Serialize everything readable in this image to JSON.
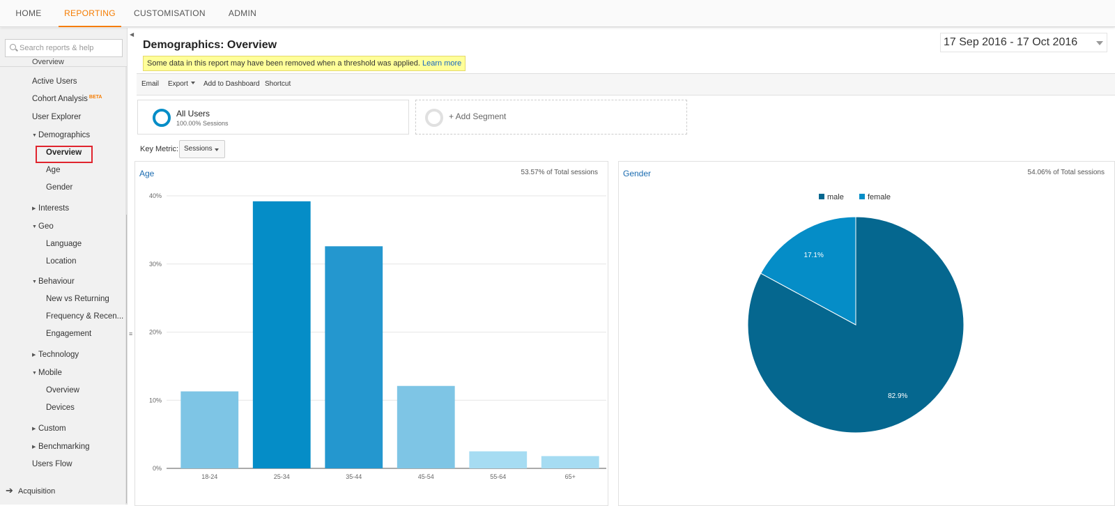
{
  "nav": {
    "tabs": [
      {
        "label": "HOME"
      },
      {
        "label": "REPORTING"
      },
      {
        "label": "CUSTOMISATION"
      },
      {
        "label": "ADMIN"
      }
    ]
  },
  "sidebar": {
    "search_placeholder": "Search reports & help",
    "cut_item": "Overview",
    "items": [
      {
        "label": "Active Users"
      },
      {
        "label": "Cohort Analysis",
        "badge": "BETA"
      },
      {
        "label": "User Explorer"
      },
      {
        "label": "Demographics"
      },
      {
        "label": "Overview"
      },
      {
        "label": "Age"
      },
      {
        "label": "Gender"
      },
      {
        "label": "Interests"
      },
      {
        "label": "Geo"
      },
      {
        "label": "Language"
      },
      {
        "label": "Location"
      },
      {
        "label": "Behaviour"
      },
      {
        "label": "New vs Returning"
      },
      {
        "label": "Frequency & Recen..."
      },
      {
        "label": "Engagement"
      },
      {
        "label": "Technology"
      },
      {
        "label": "Mobile"
      },
      {
        "label": "Overview"
      },
      {
        "label": "Devices"
      },
      {
        "label": "Custom"
      },
      {
        "label": "Benchmarking"
      },
      {
        "label": "Users Flow"
      }
    ],
    "acquisition": "Acquisition"
  },
  "header": {
    "title": "Demographics: Overview",
    "notice": "Some data in this report may have been removed when a threshold was applied.",
    "notice_link": "Learn more",
    "date_range": "17 Sep 2016 - 17 Oct 2016"
  },
  "toolbar": {
    "email": "Email",
    "export": "Export",
    "add_dashboard": "Add to Dashboard",
    "shortcut": "Shortcut"
  },
  "segments": {
    "all_name": "All Users",
    "all_sub": "100.00% Sessions",
    "add_label": "+ Add Segment"
  },
  "key_metric": {
    "label": "Key Metric:",
    "value": "Sessions"
  },
  "age_card": {
    "title": "Age",
    "pct": "53.57% of Total sessions"
  },
  "gender_card": {
    "title": "Gender",
    "pct": "54.06% of Total sessions"
  },
  "colors": {
    "accent": "#f57c00",
    "male": "#05678f",
    "female": "#058dc7"
  },
  "chart_data": [
    {
      "type": "bar",
      "categories": [
        "18-24",
        "25-34",
        "35-44",
        "45-54",
        "55-64",
        "65+"
      ],
      "values": [
        11.3,
        39.2,
        32.6,
        12.1,
        2.5,
        1.8
      ],
      "colors": [
        "#7ec5e5",
        "#058dc7",
        "#2497cf",
        "#7ec5e5",
        "#a6dcf2",
        "#a6dcf2"
      ],
      "ylim": [
        0,
        40
      ],
      "yticks": [
        "0%",
        "10%",
        "20%",
        "30%",
        "40%"
      ],
      "grid": true
    },
    {
      "type": "pie",
      "categories": [
        "male",
        "female"
      ],
      "values": [
        82.9,
        17.1
      ],
      "labels": [
        "82.9%",
        "17.1%"
      ],
      "colors": [
        "#05678f",
        "#058dc7"
      ],
      "legend": "top"
    }
  ]
}
